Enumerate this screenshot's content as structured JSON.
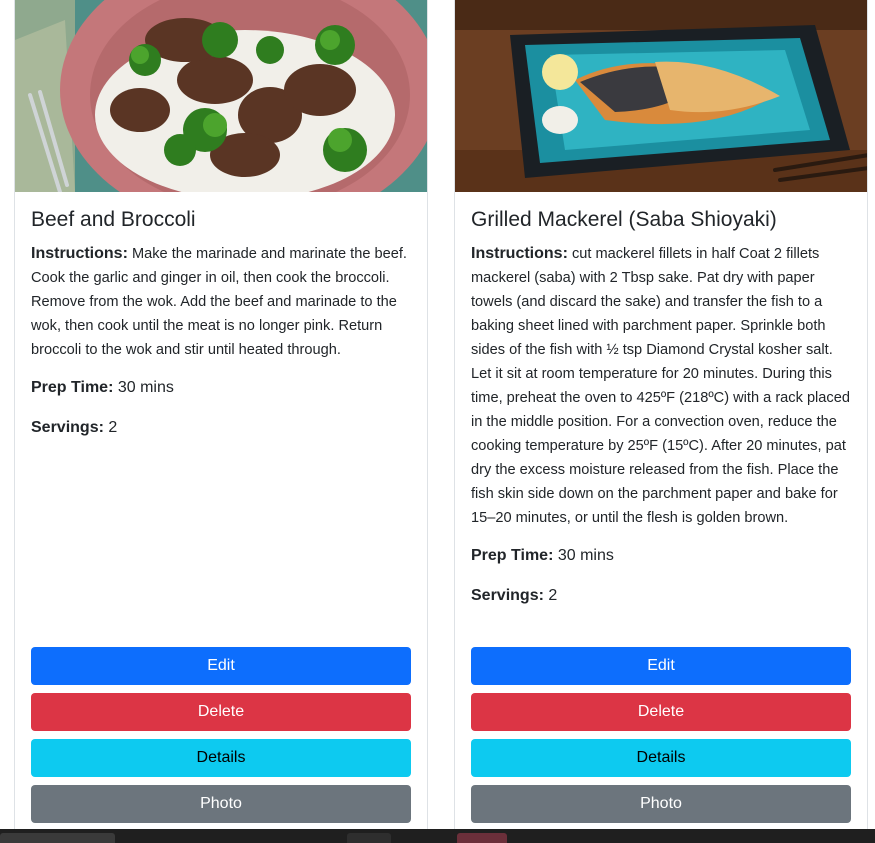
{
  "cards": [
    {
      "title": "Beef and Broccoli",
      "instructions_label": "Instructions:",
      "instructions": "Make the marinade and marinate the beef. Cook the garlic and ginger in oil, then cook the broccoli. Remove from the wok. Add the beef and marinade to the wok, then cook until the meat is no longer pink. Return broccoli to the wok and stir until heated through.",
      "prep_label": "Prep Time:",
      "prep": "30 mins",
      "servings_label": "Servings:",
      "servings": "2",
      "buttons": {
        "edit": "Edit",
        "delete": "Delete",
        "details": "Details",
        "photo": "Photo"
      }
    },
    {
      "title": "Grilled Mackerel (Saba Shioyaki)",
      "instructions_label": "Instructions:",
      "instructions": "cut mackerel fillets in half Coat 2 fillets mackerel (saba) with 2 Tbsp sake. Pat dry with paper towels (and discard the sake) and transfer the fish to a baking sheet lined with parchment paper. Sprinkle both sides of the fish with ½ tsp Diamond Crystal kosher salt. Let it sit at room temperature for 20 minutes. During this time, preheat the oven to 425ºF (218ºC) with a rack placed in the middle position. For a convection oven, reduce the cooking temperature by 25ºF (15ºC). After 20 minutes, pat dry the excess moisture released from the fish. Place the fish skin side down on the parchment paper and bake for 15–20 minutes, or until the flesh is golden brown.",
      "prep_label": "Prep Time:",
      "prep": "30 mins",
      "servings_label": "Servings:",
      "servings": "2",
      "buttons": {
        "edit": "Edit",
        "delete": "Delete",
        "details": "Details",
        "photo": "Photo"
      }
    }
  ],
  "colors": {
    "primary": "#0d6efd",
    "danger": "#dc3545",
    "info": "#0dcaf0",
    "secondary": "#6c757d"
  }
}
